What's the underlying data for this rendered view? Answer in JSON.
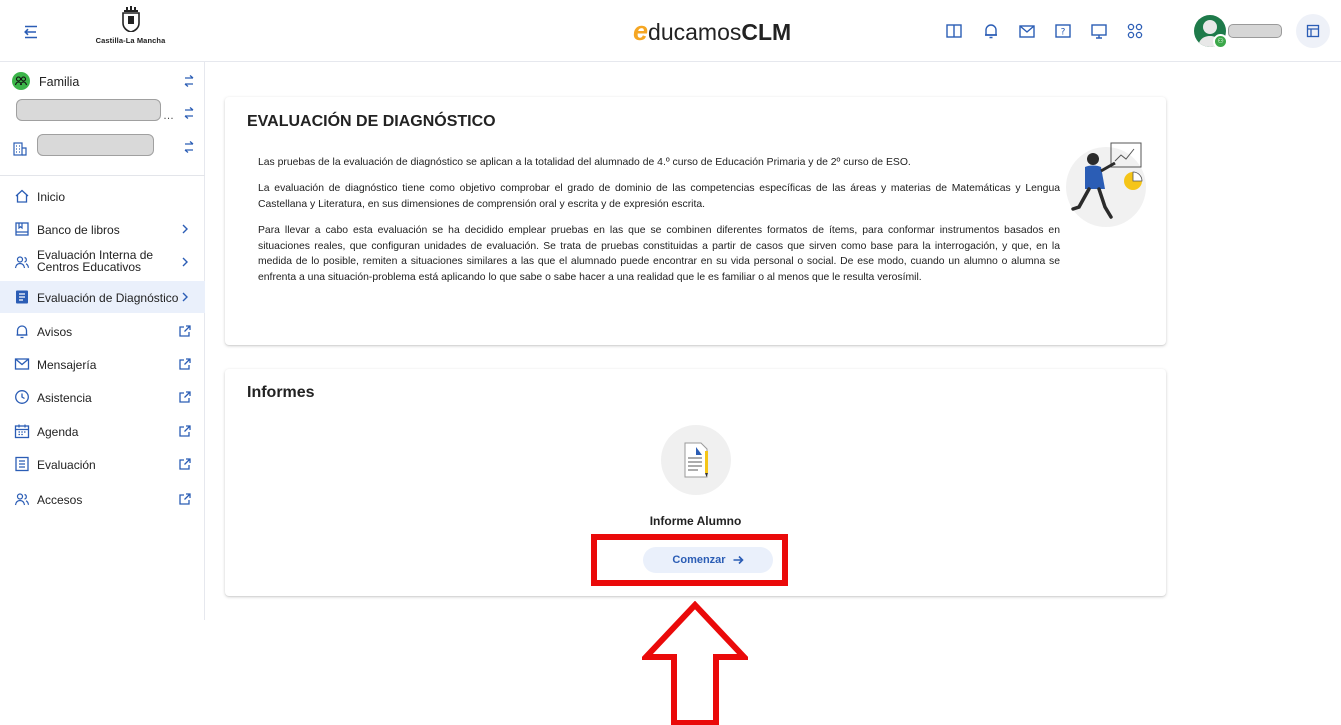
{
  "header": {
    "logo_text": "Castilla-La Mancha",
    "brand_e": "e",
    "brand_rest": "ducamos",
    "brand_clm": "CLM",
    "icons": [
      "book-icon",
      "bell-icon",
      "mail-icon",
      "help-icon",
      "monitor-icon",
      "apps-icon"
    ],
    "accent_color": "#2b5db5",
    "brand_color": "#f5a623"
  },
  "sidebar": {
    "profile_label": "Familia",
    "items": [
      {
        "label": "Inicio",
        "icon": "home-icon",
        "right": ""
      },
      {
        "label": "Banco de libros",
        "icon": "book-icon",
        "right": "chevron"
      },
      {
        "label": "Evaluación Interna de",
        "label2": "Centros Educativos",
        "icon": "people-icon",
        "right": "chevron"
      },
      {
        "label": "Evaluación de Diagnóstico",
        "icon": "document-icon",
        "right": "chevron",
        "active": true
      },
      {
        "label": "Avisos",
        "icon": "bell-icon",
        "right": "external"
      },
      {
        "label": "Mensajería",
        "icon": "mail-icon",
        "right": "external"
      },
      {
        "label": "Asistencia",
        "icon": "clock-icon",
        "right": "external"
      },
      {
        "label": "Agenda",
        "icon": "calendar-icon",
        "right": "external"
      },
      {
        "label": "Evaluación",
        "icon": "list-icon",
        "right": "external"
      },
      {
        "label": "Accesos",
        "icon": "people-icon",
        "right": "external"
      }
    ]
  },
  "main": {
    "eval_title": "EVALUACIÓN DE DIAGNÓSTICO",
    "paragraphs": [
      "Las pruebas de la evaluación de diagnóstico se aplican a la totalidad del alumnado de 4.º curso de Educación Primaria y de 2º curso de ESO.",
      "La evaluación de diagnóstico tiene como objetivo comprobar el grado de dominio de las competencias específicas de las áreas y materias de Matemáticas y Lengua Castellana y Literatura, en sus dimensiones de comprensión oral y escrita y de expresión escrita.",
      "Para llevar a cabo esta evaluación se ha decidido emplear pruebas en las que se combinen diferentes formatos de ítems, para conformar instrumentos basados en situaciones reales, que configuran unidades de evaluación. Se trata de pruebas constituidas a partir de casos que sirven como base para la interrogación, y que, en la medida de lo posible, remiten a situaciones similares a las que el alumnado puede encontrar en su vida personal o social. De ese modo, cuando un alumno o alumna se enfrenta a una situación-problema está aplicando lo que sabe o sabe hacer a una realidad que le es familiar o al menos que le resulta verosímil."
    ],
    "informes_title": "Informes",
    "report_title": "Informe Alumno",
    "start_label": "Comenzar",
    "highlight_color": "#ea0a0a"
  }
}
